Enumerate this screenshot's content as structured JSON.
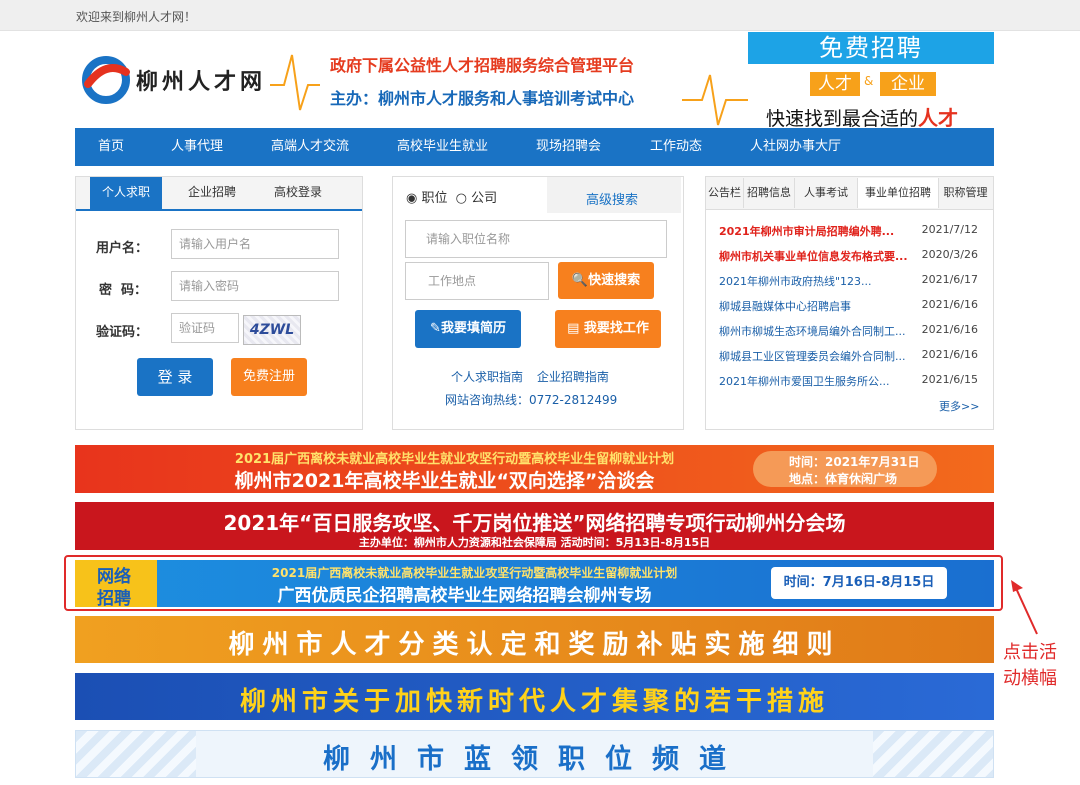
{
  "topbar": {
    "welcome": "欢迎来到柳州人才网！"
  },
  "header": {
    "logo_text": "柳州人才网",
    "slogan1": "政府下属公益性人才招聘服务综合管理平台",
    "slogan2": "主办：柳州市人才服务和人事培训考试中心",
    "ad_title": "免费招聘",
    "ad_tag1": "人才",
    "ad_amp": "&",
    "ad_tag2": "企业",
    "ad_line": "快速找到最合适的",
    "ad_highlight": "人才"
  },
  "nav": {
    "items": [
      "首页",
      "人事代理",
      "高端人才交流",
      "高校毕业生就业",
      "现场招聘会",
      "工作动态",
      "人社网办事大厅"
    ]
  },
  "login": {
    "tabs": [
      "个人求职",
      "企业招聘",
      "高校登录"
    ],
    "username_label": "用户名：",
    "username_placeholder": "请输入用户名",
    "password_label": "密  码：",
    "password_placeholder": "请输入密码",
    "captcha_label": "验证码：",
    "captcha_placeholder": "验证码",
    "captcha_text": "4ZWL",
    "login_button": "登 录",
    "register_button": "免费注册"
  },
  "search": {
    "radio_job": "职位",
    "radio_company": "公司",
    "advanced": "高级搜索",
    "job_placeholder": "请输入职位名称",
    "location_placeholder": "工作地点",
    "quick_search": "快速搜索",
    "resume_button": "我要填简历",
    "find_job_button": "我要找工作",
    "guide_personal": "个人求职指南",
    "guide_company": "企业招聘指南",
    "hotline": "网站咨询热线：0772-2812499"
  },
  "news": {
    "tabs": [
      "公告栏",
      "招聘信息",
      "人事考试",
      "事业单位招聘",
      "职称管理"
    ],
    "items": [
      {
        "title": "2021年柳州市审计局招聘编外聘...",
        "date": "2021/7/12",
        "highlight": true
      },
      {
        "title": "柳州市机关事业单位信息发布格式要...",
        "date": "2020/3/26",
        "highlight": true
      },
      {
        "title": "2021年柳州市政府热线\"123...",
        "date": "2021/6/17",
        "highlight": false
      },
      {
        "title": "柳城县融媒体中心招聘启事",
        "date": "2021/6/16",
        "highlight": false
      },
      {
        "title": "柳州市柳城生态环境局编外合同制工...",
        "date": "2021/6/16",
        "highlight": false
      },
      {
        "title": "柳城县工业区管理委员会编外合同制...",
        "date": "2021/6/16",
        "highlight": false
      },
      {
        "title": "2021年柳州市爱国卫生服务所公...",
        "date": "2021/6/15",
        "highlight": false
      }
    ],
    "more": "更多>>"
  },
  "banners": {
    "b1_line1": "2021届广西离校未就业高校毕业生就业攻坚行动暨高校毕业生留柳就业计划",
    "b1_line2": "柳州市2021年高校毕业生就业“双向选择”洽谈会",
    "b1_time": "时间：2021年7月31日",
    "b1_place": "地点：体育休闲广场",
    "b2_line1": "2021年“百日服务攻坚、千万岗位推送”网络招聘专项行动柳州分会场",
    "b2_line2": "主办单位：柳州市人力资源和社会保障局    活动时间：5月13日-8月15日",
    "b3_badge1": "网络",
    "b3_badge2": "招聘",
    "b3_line1": "2021届广西离校未就业高校毕业生就业攻坚行动暨高校毕业生留柳就业计划",
    "b3_line2": "广西优质民企招聘高校毕业生网络招聘会柳州专场",
    "b3_time": "时间：7月16日-8月15日",
    "b4": "柳州市人才分类认定和奖励补贴实施细则",
    "b5": "柳州市关于加快新时代人才集聚的若干措施",
    "b6": "柳州市蓝领职位频道"
  },
  "annotation": {
    "label": "点击活动横幅"
  },
  "colors": {
    "nav_blue": "#1a73c5",
    "orange": "#f7801e",
    "red": "#e02a2a"
  }
}
